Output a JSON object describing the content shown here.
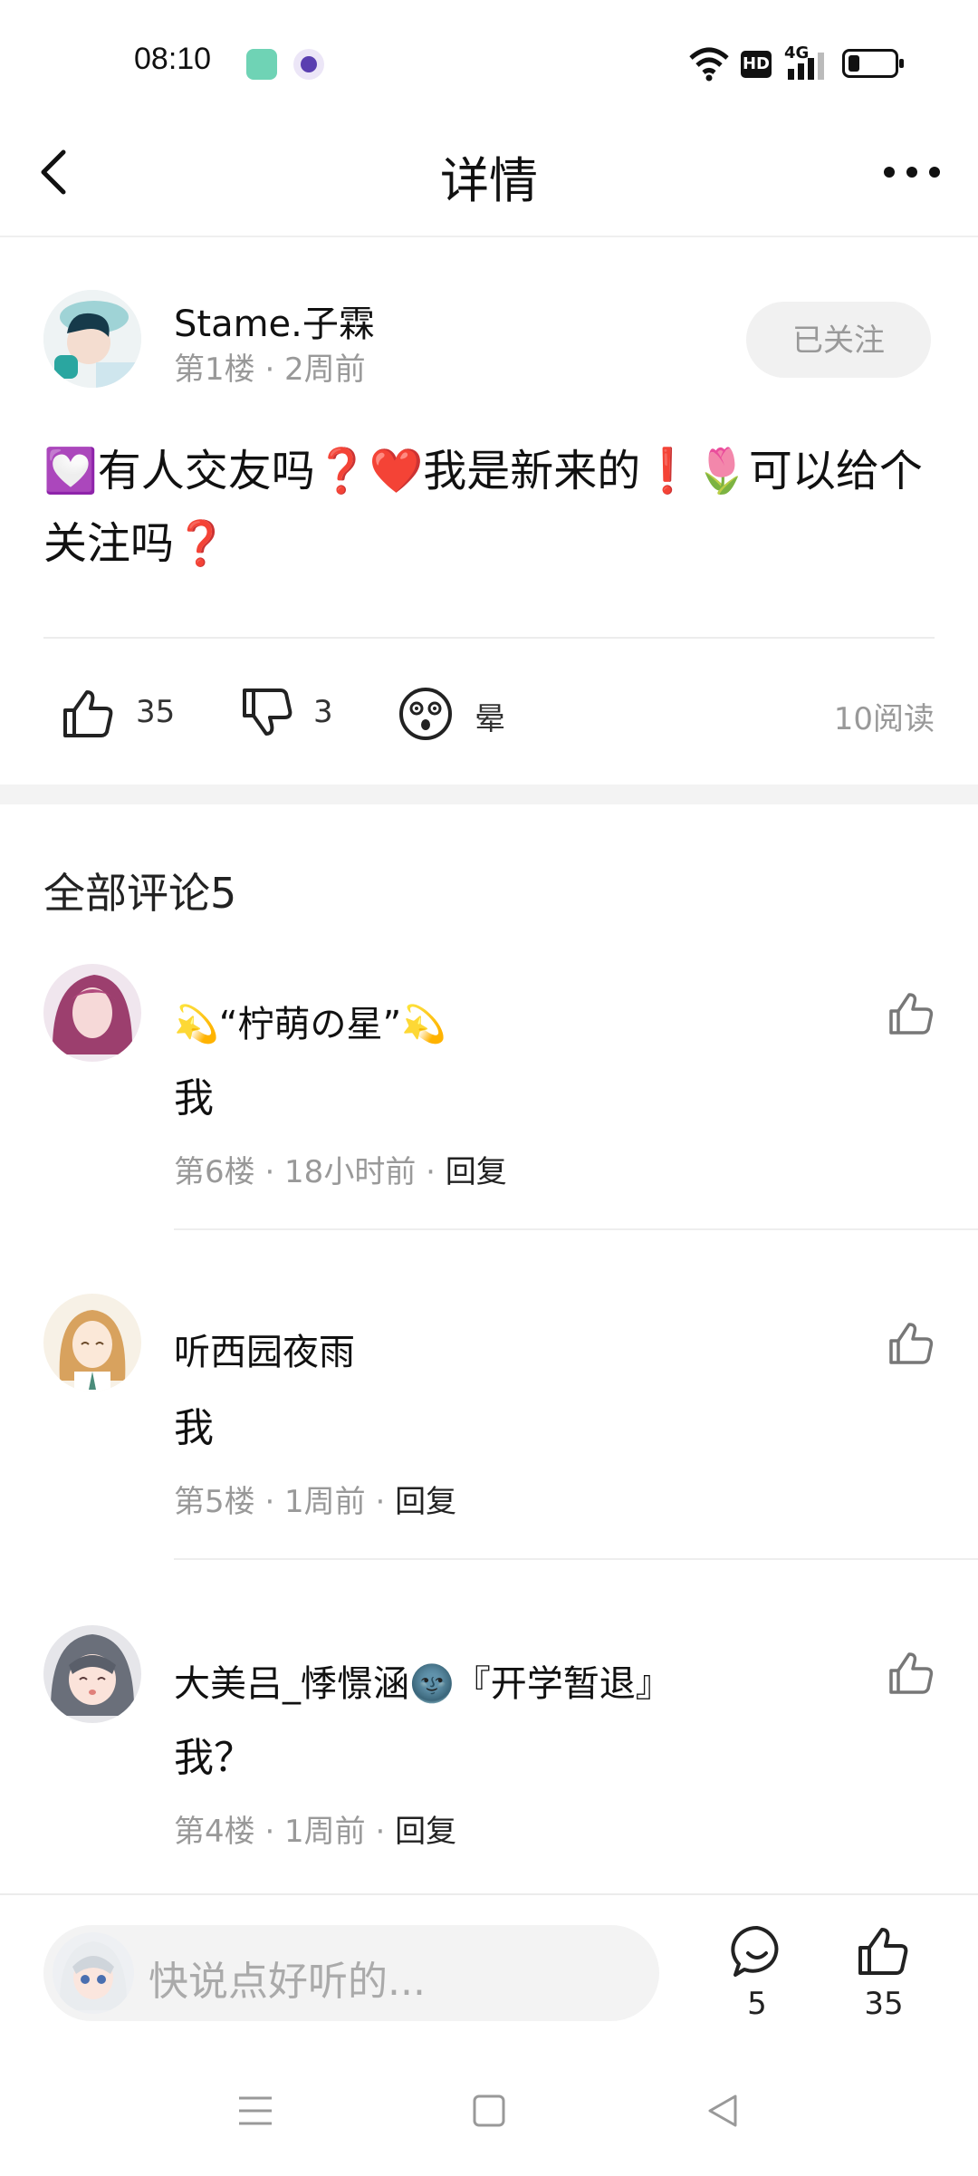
{
  "status_bar": {
    "time": "08:10",
    "network_label": "4G",
    "hd_label": "HD"
  },
  "header": {
    "title": "详情"
  },
  "post": {
    "author": "Stame.子霖",
    "meta": "第1楼 · 2周前",
    "follow_label": "已关注",
    "body": "💟有人交友吗❓❤️我是新来的❗🌷可以给个关注吗❓",
    "likes": "35",
    "dislikes": "3",
    "reaction_label": "晕",
    "read_count": "10阅读"
  },
  "comments": {
    "title": "全部评论5",
    "items": [
      {
        "name": "💫“柠萌の星”💫",
        "body": "我",
        "meta": "第6楼 · 18小时前 · ",
        "reply": "回复"
      },
      {
        "name": "听西园夜雨",
        "body": "我",
        "meta": "第5楼 · 1周前 · ",
        "reply": "回复"
      },
      {
        "name": "大美吕_悸憬涵🌚『开学暂退』",
        "body": "我？",
        "meta": "第4楼 · 1周前 · ",
        "reply": "回复"
      }
    ]
  },
  "bottom_bar": {
    "placeholder": "快说点好听的...",
    "comment_count": "5",
    "like_count": "35"
  },
  "colors": {
    "accent_red": "#e8323c",
    "meta_gray": "#999999",
    "pill_bg": "#f1f1f1"
  },
  "icons": [
    "back-icon",
    "more-icon",
    "thumb-up-icon",
    "thumb-down-icon",
    "dizzy-face-icon",
    "comment-icon",
    "menu-nav-icon",
    "home-nav-icon",
    "back-nav-icon"
  ]
}
